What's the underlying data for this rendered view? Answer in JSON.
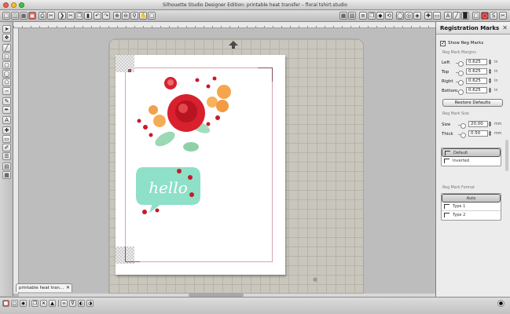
{
  "window": {
    "title": "Silhouette Studio Designer Edition: printable heat transfer – floral tshirt.studio"
  },
  "colors": {
    "accent_red": "#d8202e",
    "reg_line": "#d7a6b3",
    "speech_mint": "#8ee0c8",
    "mat": "#c9c6bd"
  },
  "document_tab": {
    "label": "printable heat tran..."
  },
  "canvas": {
    "artwork_text": "hello"
  },
  "panel": {
    "title": "Registration Marks",
    "show_reg_marks": {
      "label": "Show Reg Marks",
      "checked": true
    },
    "margins": {
      "section": "Reg Mark Margins",
      "fields": [
        {
          "label": "Left",
          "value": "0.625",
          "unit": "in"
        },
        {
          "label": "Top",
          "value": "0.625",
          "unit": "in"
        },
        {
          "label": "Right",
          "value": "0.625",
          "unit": "in"
        },
        {
          "label": "Bottom",
          "value": "0.625",
          "unit": "in"
        }
      ]
    },
    "restore_label": "Restore Defaults",
    "size": {
      "section": "Reg Mark Size",
      "fields": [
        {
          "label": "Size",
          "value": "20.00",
          "unit": "mm"
        },
        {
          "label": "Thick",
          "value": "0.50",
          "unit": "mm"
        }
      ]
    },
    "style_options": [
      {
        "label": "Default",
        "selected": true
      },
      {
        "label": "Inverted",
        "selected": false
      }
    ],
    "format": {
      "section": "Reg Mark Format",
      "options": [
        {
          "label": "Auto",
          "selected": true
        },
        {
          "label": "Type 1",
          "selected": false
        },
        {
          "label": "Type 2",
          "selected": false
        }
      ]
    }
  }
}
